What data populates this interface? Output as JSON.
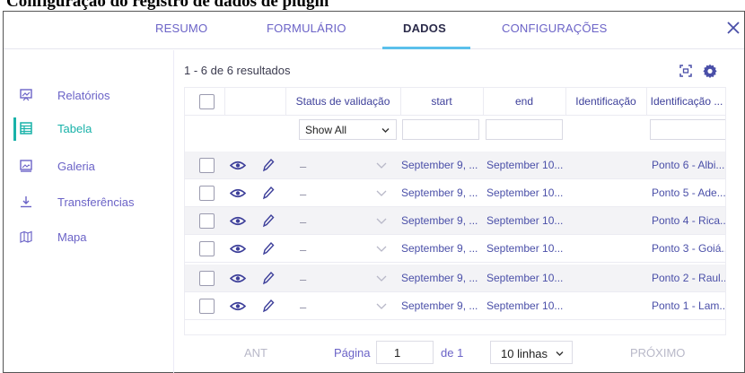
{
  "document": {
    "partial_heading": "Configuração do registro de dados de plugin"
  },
  "header": {
    "tabs": [
      {
        "label": "RESUMO"
      },
      {
        "label": "FORMULÁRIO"
      },
      {
        "label": "DADOS"
      },
      {
        "label": "CONFIGURAÇÕES"
      }
    ],
    "active_tab": "DADOS",
    "close_icon": "close-icon"
  },
  "sidebar": {
    "items": [
      {
        "label": "Relatórios",
        "icon": "reports-icon"
      },
      {
        "label": "Tabela",
        "icon": "table-icon"
      },
      {
        "label": "Galeria",
        "icon": "gallery-icon"
      },
      {
        "label": "Transferências",
        "icon": "download-icon"
      },
      {
        "label": "Mapa",
        "icon": "map-icon"
      }
    ],
    "active": "Tabela"
  },
  "results": {
    "text": "1 - 6 de 6 resultados"
  },
  "toolbar": {
    "icons": [
      "fullscreen-icon",
      "gear-icon"
    ]
  },
  "table": {
    "columns": [
      "Status de validação",
      "start",
      "end",
      "Identificação",
      "Identificação ..."
    ],
    "filter_status_value": "Show All",
    "rows": [
      {
        "status": "–",
        "start": "September 9, ...",
        "end": "September 10...",
        "identificacao": "",
        "identificacao2": "Ponto 6 - Albi..."
      },
      {
        "status": "–",
        "start": "September 9, ...",
        "end": "September 10...",
        "identificacao": "",
        "identificacao2": "Ponto 5 - Ade..."
      },
      {
        "status": "–",
        "start": "September 9, ...",
        "end": "September 10...",
        "identificacao": "",
        "identificacao2": "Ponto 4 - Rica..."
      },
      {
        "status": "–",
        "start": "September 9, ...",
        "end": "September 10...",
        "identificacao": "",
        "identificacao2": "Ponto 3 - Goiá..."
      },
      {
        "status": "–",
        "start": "September 9, ...",
        "end": "September 10...",
        "identificacao": "",
        "identificacao2": "Ponto 2 - Raul..."
      },
      {
        "status": "–",
        "start": "September 9, ...",
        "end": "September 10...",
        "identificacao": "",
        "identificacao2": "Ponto 1 - Lam..."
      }
    ]
  },
  "pagination": {
    "prev_label": "ANT",
    "page_label": "Página",
    "page_value": "1",
    "of_label": "de 1",
    "rows_value": "10 linhas",
    "next_label": "PRÓXIMO"
  },
  "colors": {
    "accent": "#19b2a9",
    "link": "#6b63c7",
    "tab_underline": "#5bc0eb"
  }
}
